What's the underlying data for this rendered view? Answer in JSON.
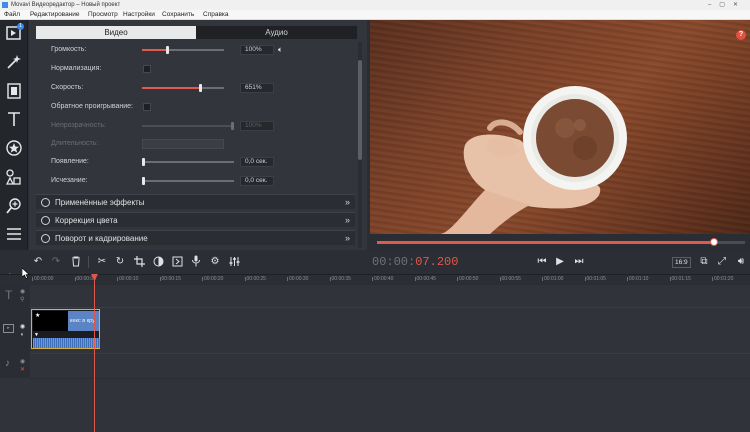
{
  "window": {
    "title": "Movavi Видеоредактор – Новый проект"
  },
  "menu": [
    "Файл",
    "Редактирование",
    "Просмотр",
    "Настройки",
    "Сохранить",
    "Справка"
  ],
  "sidebar": {
    "import_badge": "1"
  },
  "panel": {
    "tabs": [
      "Видео",
      "Аудио"
    ],
    "rows": {
      "volume": {
        "label": "Громкость:",
        "value": "100%",
        "level": 0.32
      },
      "normalize": {
        "label": "Нормализация:"
      },
      "speed": {
        "label": "Скорость:",
        "value": "651%",
        "level": 0.72
      },
      "reverse": {
        "label": "Обратное проигрывание:"
      },
      "opacity": {
        "label": "Непрозрачность:",
        "value": "100%"
      },
      "duration": {
        "label": "Длительность:"
      },
      "fadein": {
        "label": "Появление:",
        "value": "0,0 сек."
      },
      "fadeout": {
        "label": "Исчезание:",
        "value": "0,0 сек."
      }
    },
    "sections": [
      "Применённые эффекты",
      "Коррекция цвета",
      "Поворот и кадрирование"
    ]
  },
  "preview": {
    "help": "?",
    "progress": 0.91
  },
  "timecode": {
    "dim": "00:00:",
    "active": "07.200"
  },
  "toolbar": {
    "ratio": "16:9"
  },
  "ruler": [
    "00:00:00",
    "00:00:05",
    "00:00:10",
    "00:00:15",
    "00:00:20",
    "00:00:25",
    "00:00:30",
    "00:00:35",
    "00:00:40",
    "00:00:45",
    "00:00:50",
    "00:00:55",
    "00:01:00",
    "00:01:05",
    "00:01:10",
    "00:01:15",
    "00:01:20"
  ],
  "clip": {
    "title": "кекс в кру"
  },
  "colors": {
    "accent": "#e05b4b",
    "clip_border": "#d6b04a",
    "clip_blue": "#5b84c4"
  }
}
